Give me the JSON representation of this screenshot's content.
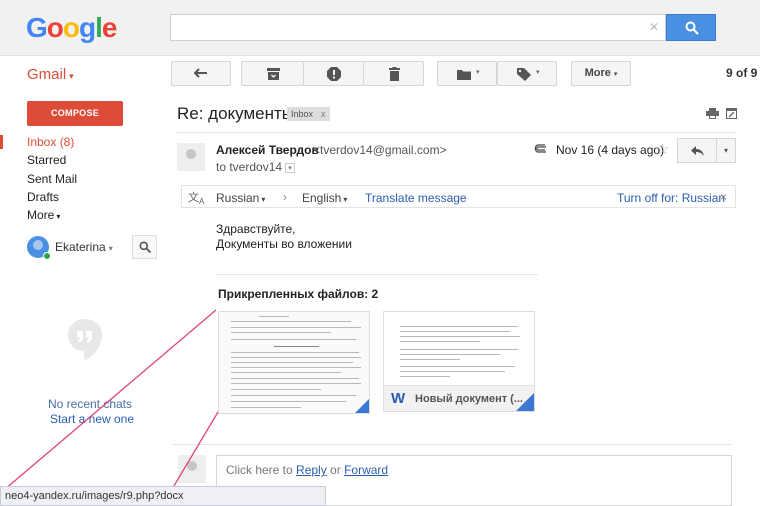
{
  "header": {
    "logo": "Google",
    "search": {
      "value": "",
      "placeholder": "",
      "clear_glyph": "✕"
    }
  },
  "toolbar": {
    "app_label": "Gmail",
    "caret": "▾",
    "back_icon": "arrow-left-icon",
    "archive_icon": "archive-icon",
    "spam_icon": "report-spam-icon",
    "delete_icon": "trash-icon",
    "move_icon": "folder-icon",
    "labels_icon": "label-icon",
    "more_label": "More",
    "pager": "9 of 9"
  },
  "sidebar": {
    "compose_label": "COMPOSE",
    "items": [
      {
        "label": "Inbox (8)",
        "active": true
      },
      {
        "label": "Starred"
      },
      {
        "label": "Sent Mail"
      },
      {
        "label": "Drafts"
      },
      {
        "label": "More"
      }
    ],
    "user_name": "Ekaterina",
    "no_chats": "No recent chats",
    "start_chat": "Start a new one"
  },
  "message": {
    "subject": "Re: документы",
    "label": "Inbox",
    "label_close": "x",
    "sender_name": "Алексей Твердов",
    "sender_email": "<tverdov14@gmail.com>",
    "to": "to tverdov14",
    "date": "Nov 16 (4 days ago)",
    "star": "☆",
    "translate": {
      "from": "Russian",
      "to": "English",
      "arrow": "›",
      "action": "Translate message",
      "turn_off": "Turn off for: Russian",
      "close": "×"
    },
    "body": [
      "Здравствуйте,",
      "Документы во вложении"
    ],
    "attachments_title": "Прикрепленных файлов: 2",
    "attachments": [
      {
        "name": ""
      },
      {
        "name": "Новый документ (...",
        "type_glyph": "W"
      }
    ]
  },
  "reply": {
    "prefix": "Click here to ",
    "reply_link": "Reply",
    "middle": " or ",
    "forward_link": "Forward"
  },
  "status_bar": {
    "url": "neo4-yandex.ru/images/r9.php?docx"
  },
  "colors": {
    "accent_red": "#dd4b39",
    "search_blue": "#4a90e2",
    "link_blue": "#2a5db0",
    "overlay_pink": "#e0457b"
  }
}
